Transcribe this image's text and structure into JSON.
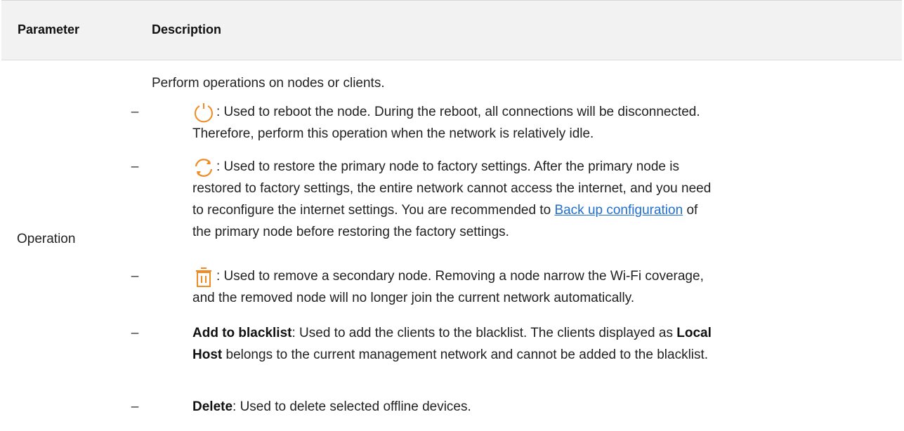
{
  "table": {
    "headers": {
      "parameter": "Parameter",
      "description": "Description"
    },
    "row": {
      "parameter": "Operation",
      "intro": "Perform operations on nodes or clients.",
      "items": [
        {
          "icon": "power-icon",
          "line1": ": Used to reboot the node. During the reboot, all connections will be disconnected.",
          "line2": "Therefore, perform this operation when the network is relatively idle."
        },
        {
          "icon": "restore-icon",
          "line1": ": Used to restore the primary node to factory settings. After the primary node is",
          "line2": "restored to factory settings, the entire network cannot access the internet, and you need",
          "line3_pre": "to reconfigure the internet settings. You are recommended to ",
          "line3_link": "Back up configuration",
          "line3_post": " of",
          "line4": "the primary node before restoring the factory settings."
        },
        {
          "icon": "trash-icon",
          "line1": ": Used to remove a secondary node. Removing a node narrow the Wi-Fi coverage,",
          "line2": "and the removed node will no longer join the current network automatically."
        },
        {
          "bold": "Add to blacklist",
          "line1_rest": ": Used to add the clients to the blacklist. The clients displayed as ",
          "bold2": "Local",
          "line2_bold": "Host",
          "line2_rest": " belongs to the current management network and cannot be added to the blacklist."
        },
        {
          "bold": "Delete",
          "line1_rest": ": Used to delete selected offline devices."
        }
      ]
    }
  },
  "colors": {
    "accent": "#f08a24",
    "link": "#1f6fd1",
    "header_bg": "#f2f2f2"
  }
}
